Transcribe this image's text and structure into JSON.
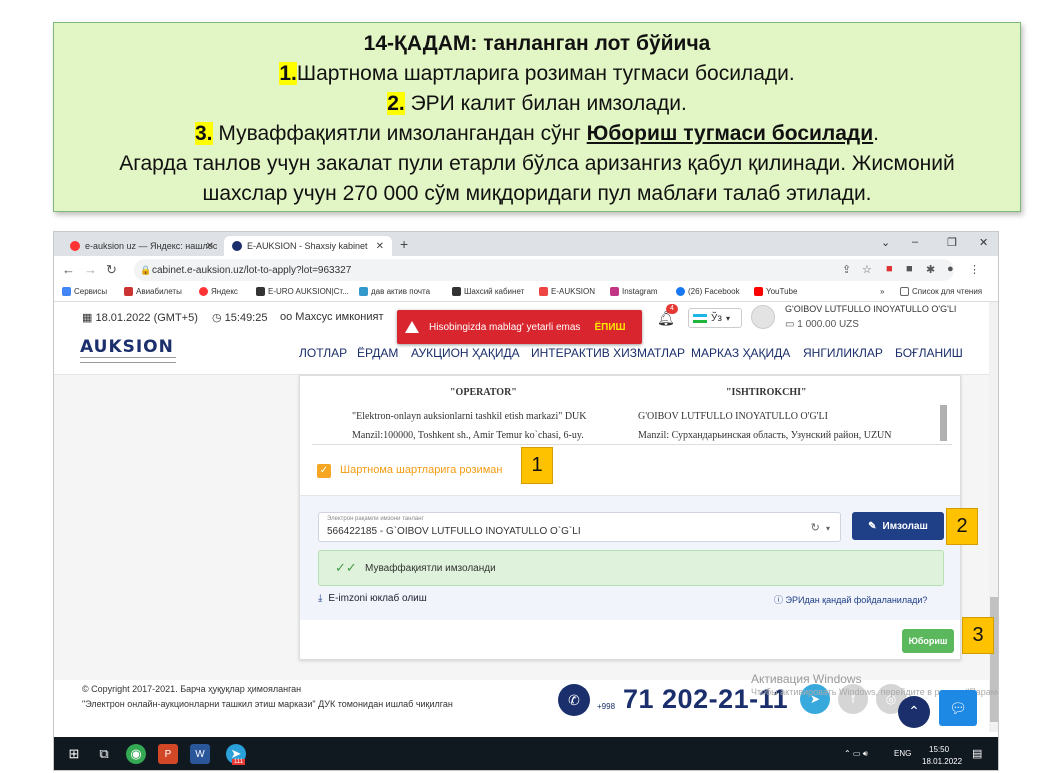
{
  "instructions": {
    "step_prefix": "14-ҚАДАМ",
    "step_title": ": танланган лот бўйича",
    "n1": "1.",
    "line1": "Шартнома шартларига розиман тугмаси босилади.",
    "n2": "2.",
    "line2": " ЭРИ калит билан имзолади.",
    "n3": "3.",
    "line3_a": " Муваффақиятли имзолангандан сўнг ",
    "line3_b": "Юбориш тугмаси босилади",
    "line3_c": ".",
    "line4": "Агарда танлов учун закалат пули етарли бўлса аризангиз қабул қилинади. Жисмоний",
    "line5": "шахслар учун 270 000 сўм миқдоридаги пул маблағи талаб этилади."
  },
  "browser": {
    "tabs": [
      {
        "label": "e-auksion uz — Яндекс: нашлос",
        "close": "✕"
      },
      {
        "label": "E-AUKSION - Shaxsiy kabinet",
        "close": "✕"
      }
    ],
    "new_tab": "+",
    "url": "cabinet.e-auksion.uz/lot-to-apply?lot=963327",
    "bookmarks": [
      "Сервисы",
      "Авиабилеты",
      "Яндекс",
      "E-URO AUKSION|Ст...",
      "дав актив почта",
      "Шахсий кабинет",
      "E-AUKSION",
      "Instagram",
      "(26) Facebook",
      "YouTube"
    ],
    "reading_list": "Список для чтения",
    "overflow": "»"
  },
  "site": {
    "date": "18.01.2022 (GMT+5)",
    "time": "15:49:25",
    "special": "Махсус имконият",
    "alert_text": "Hisobingizda mablag' yetarli emas",
    "alert_action": "ЁПИШ",
    "notif_count": "4",
    "language": "Ўз",
    "user_name": "G'OIBOV LUTFULLO INOYATULLO O'G'LI",
    "balance": "1 000.00 UZS",
    "logo": "AUKSION",
    "menu": [
      "ЛОТЛАР",
      "ЁРДАМ",
      "АУКЦИОН ҲАҚИДА",
      "ИНТЕРАКТИВ ХИЗМАТЛАР",
      "МАРКАЗ ҲАҚИДА",
      "ЯНГИЛИКЛАР",
      "БОҒЛАНИШ"
    ]
  },
  "contract": {
    "operator_title": "\"OPERATOR\"",
    "participant_title": "\"ISHTIROKCHI\"",
    "operator_name": "\"Elektron-onlayn auksionlarni tashkil etish markazi\" DUK",
    "operator_addr": "Manzil:100000, Toshkent sh., Amir Temur ko`chasi, 6-uy.",
    "participant_name": "G'OIBOV LUTFULLO INOYATULLO O'G'LI",
    "participant_addr": "Manzil: Сурхандарьинская область, Узунский район, UZUN"
  },
  "form": {
    "agree_label": "Шартнома шартларига розиман",
    "select_label": "Электрон рақамли имзони танланг",
    "select_value": "566422185 - G`OIBOV LUTFULLO INOYATULLO O`G`LI",
    "sign_button": "Имзолаш",
    "success_text": "Муваффақиятли имзоланди",
    "download_link": "E-imzoni юклаб олиш",
    "help_link": "ЭРИдан қандай фойдаланилади?",
    "send_button": "Юбориш"
  },
  "footer": {
    "copyright": "© Copyright 2017-2021. Барча ҳуқуқлар ҳимояланган",
    "org": "\"Электрон онлайн-аукционларни ташкил этиш маркази\" ДУК томонидан ишлаб чиқилган",
    "phone_prefix": "+998",
    "phone": "71 202-21-11",
    "activation_title": "Активация Windows",
    "activation_sub": "Чтобы активировать Windows, перейдите в раздел \"Параметры\"."
  },
  "taskbar": {
    "lang": "ENG",
    "time": "15:50",
    "date": "18.01.2022",
    "badge": "111"
  },
  "markers": [
    "1",
    "2",
    "3"
  ],
  "colors": {
    "instruction_bg": "#e2f5c4",
    "highlight": "#ffff00",
    "alert_bg": "#d9262e",
    "primary": "#1f3f86",
    "success_bg": "#dff3dc",
    "send": "#5cb85c",
    "marker": "#ffc200",
    "agree": "#f5a623"
  }
}
